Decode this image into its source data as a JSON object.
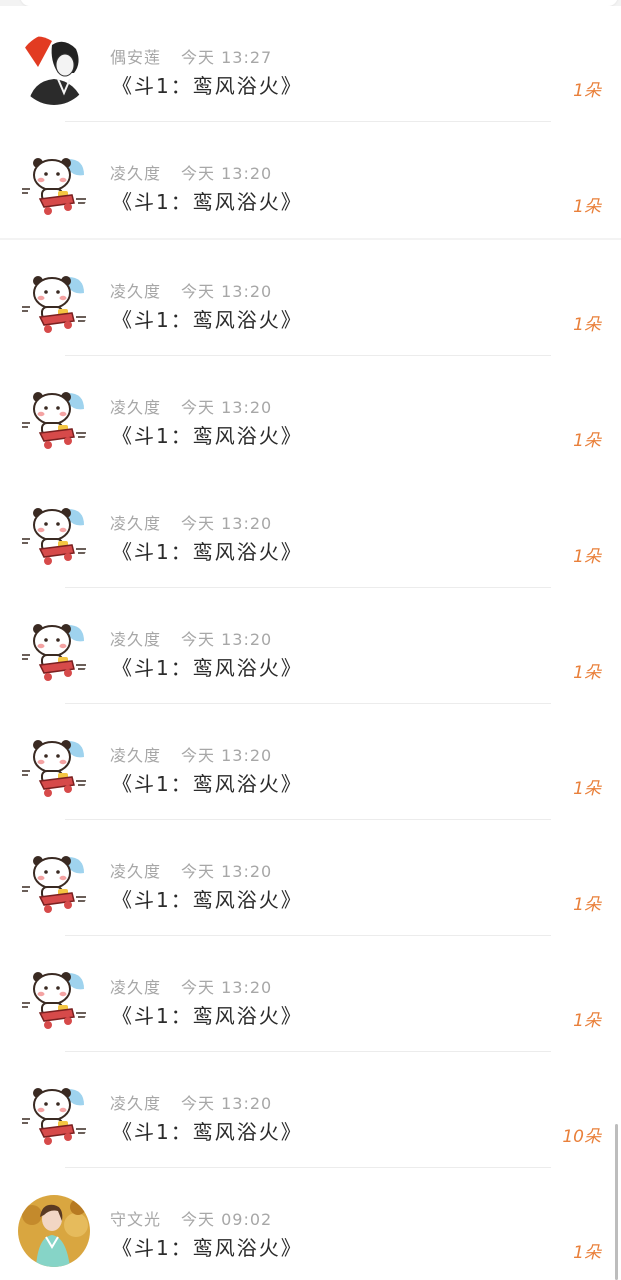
{
  "list": {
    "items": [
      {
        "sender": "偶安莲",
        "time": "今天 13:27",
        "message": "《斗1：鸾风浴火》",
        "amount": "1朵",
        "avatar": "boy-avatar-icon"
      },
      {
        "sender": "凌久度",
        "time": "今天 13:20",
        "message": "《斗1：鸾风浴火》",
        "amount": "1朵",
        "avatar": "panda-sticker-icon"
      },
      {
        "sender": "凌久度",
        "time": "今天 13:20",
        "message": "《斗1：鸾风浴火》",
        "amount": "1朵",
        "avatar": "panda-sticker-icon"
      },
      {
        "sender": "凌久度",
        "time": "今天 13:20",
        "message": "《斗1：鸾风浴火》",
        "amount": "1朵",
        "avatar": "panda-sticker-icon"
      },
      {
        "sender": "凌久度",
        "time": "今天 13:20",
        "message": "《斗1：鸾风浴火》",
        "amount": "1朵",
        "avatar": "panda-sticker-icon"
      },
      {
        "sender": "凌久度",
        "time": "今天 13:20",
        "message": "《斗1：鸾风浴火》",
        "amount": "1朵",
        "avatar": "panda-sticker-icon"
      },
      {
        "sender": "凌久度",
        "time": "今天 13:20",
        "message": "《斗1：鸾风浴火》",
        "amount": "1朵",
        "avatar": "panda-sticker-icon"
      },
      {
        "sender": "凌久度",
        "time": "今天 13:20",
        "message": "《斗1：鸾风浴火》",
        "amount": "1朵",
        "avatar": "panda-sticker-icon"
      },
      {
        "sender": "凌久度",
        "time": "今天 13:20",
        "message": "《斗1：鸾风浴火》",
        "amount": "1朵",
        "avatar": "panda-sticker-icon"
      },
      {
        "sender": "凌久度",
        "time": "今天 13:20",
        "message": "《斗1：鸾风浴火》",
        "amount": "10朵",
        "avatar": "panda-sticker-icon"
      },
      {
        "sender": "守文光",
        "time": "今天 09:02",
        "message": "《斗1：鸾风浴火》",
        "amount": "1朵",
        "avatar": "girl-photo-avatar-icon"
      }
    ]
  },
  "colors": {
    "amount": "#e9803b",
    "meta": "#a7a7a7",
    "title": "#2b2b2b",
    "background": "#f3f3f3"
  }
}
